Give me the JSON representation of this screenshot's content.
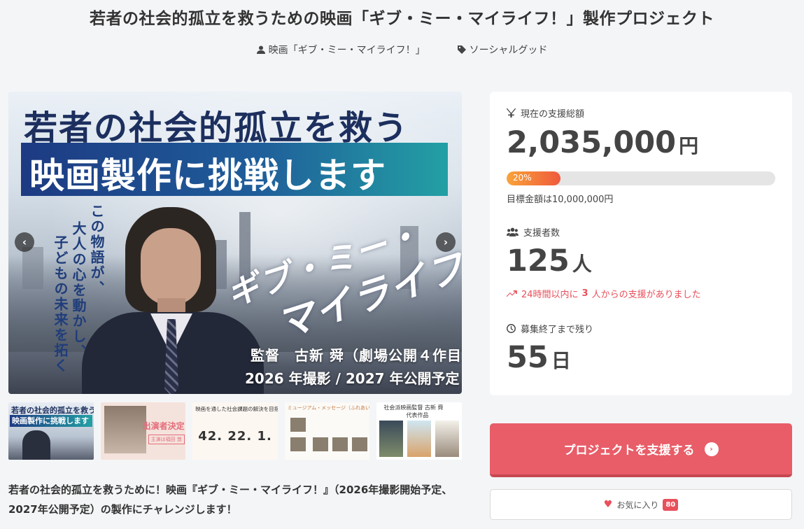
{
  "page": {
    "title": "若者の社会的孤立を救うための映画「ギブ・ミー・マイライフ！」製作プロジェクト",
    "author": "映画「ギブ・ミー・マイライフ！」",
    "category": "ソーシャルグッド",
    "description": "若者の社会的孤立を救うために！映画『ギブ・ミー・マイライフ！』（2026年撮影開始予定、2027年公開予定）の製作にチャレンジします！"
  },
  "hero": {
    "headline1": "若者の社会的孤立を救う",
    "headline2": "映画製作に挑戦します",
    "vertical_col1": "この物語が、",
    "vertical_col2": "大人の心を動かし、",
    "vertical_col3": "子どもの未来を拓く",
    "logo_line1": "ギブ・ミー・",
    "logo_line2": "マイライフ!",
    "director": "監督　古新 舜（劇場公開４作目）",
    "schedule": "2026 年撮影 / 2027 年公開予定",
    "prev_label": "‹",
    "next_label": "›"
  },
  "thumbnails": [
    {
      "title": "若者の社会的孤立を救う",
      "banner": "映画製作に挑戦します"
    },
    {
      "label": "出演者決定",
      "sub": "主演は福田 悠"
    },
    {
      "header": "映画を通した社会課題の解決を目指して",
      "numbers": "42. 22. 1."
    },
    {
      "header": "ミュージアム・メッセージ（ふれあいできること）"
    },
    {
      "header": "社会派映画監督 古新 舜",
      "header2": "代表作品"
    }
  ],
  "stats": {
    "total_label": "現在の支援総額",
    "total_value": "2,035,000",
    "total_unit": "円",
    "progress_percent": 20,
    "progress_label": "20%",
    "target_text": "目標金額は10,000,000円",
    "backers_label": "支援者数",
    "backers_value": "125",
    "backers_unit": "人",
    "trend_prefix": "24時間以内に",
    "trend_count": "3",
    "trend_suffix": "人からの支援がありました",
    "remaining_label": "募集終了まで残り",
    "remaining_value": "55",
    "remaining_unit": "日"
  },
  "actions": {
    "support_label": "プロジェクトを支援する",
    "support_arrow": "›",
    "favorite_label": "お気に入り",
    "favorite_count": "80"
  },
  "colors": {
    "accent": "#e85d68",
    "trend": "#e8505b",
    "progress_start": "#f9a33a",
    "progress_end": "#ef5a3c"
  },
  "icons": [
    "user-icon",
    "tag-icon",
    "yen-icon",
    "users-icon",
    "trend-up-icon",
    "clock-icon",
    "heart-icon",
    "arrow-circle-icon"
  ]
}
